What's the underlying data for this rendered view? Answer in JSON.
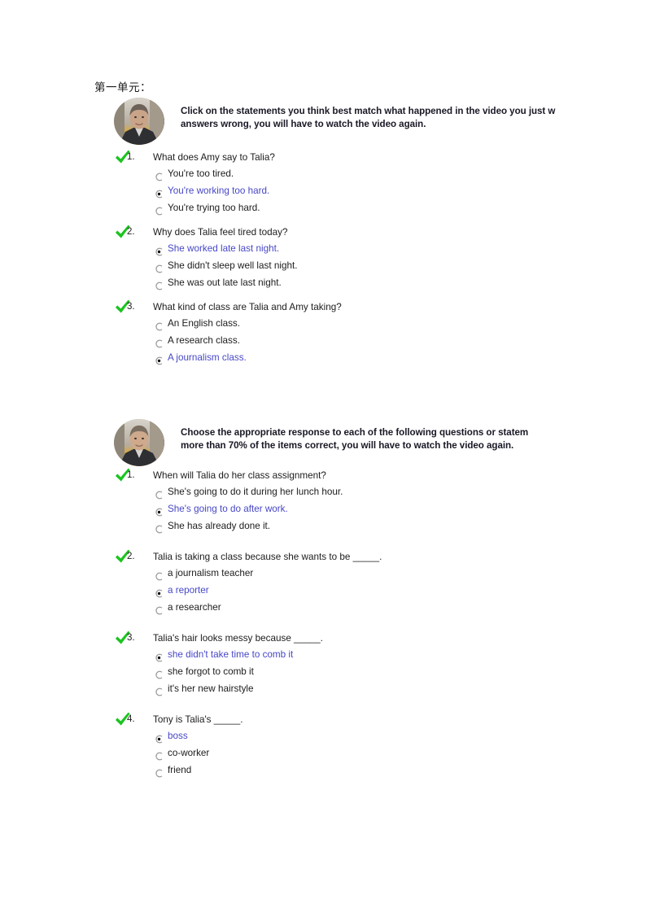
{
  "page": {
    "unit_heading": "第一单元：",
    "background_color": "#ffffff",
    "selected_option_color": "#4747c8",
    "default_text_color": "#1c1c1c",
    "check_color": "#16c21a"
  },
  "sections": [
    {
      "id": "section-1",
      "avatar_name": "instructor-avatar",
      "intro_lines": [
        "Click on the statements you think best match what happened in the video you just w",
        "answers wrong, you will have to watch the video again."
      ],
      "questions": [
        {
          "number": "1.",
          "status_icon": "green-check-icon",
          "text": "What does Amy say to Talia?",
          "options": [
            {
              "label": "You're too tired.",
              "selected": false
            },
            {
              "label": "You're working too hard.",
              "selected": true
            },
            {
              "label": "You're trying too hard.",
              "selected": false
            }
          ]
        },
        {
          "number": "2.",
          "status_icon": "green-check-icon",
          "text": "Why does Talia feel tired today?",
          "options": [
            {
              "label": "She worked late last night.",
              "selected": true
            },
            {
              "label": "She didn't sleep well last night.",
              "selected": false
            },
            {
              "label": "She was out late last night.",
              "selected": false
            }
          ]
        },
        {
          "number": "3.",
          "status_icon": "green-check-icon",
          "text": "What kind of class are Talia and Amy taking?",
          "options": [
            {
              "label": "An English class.",
              "selected": false
            },
            {
              "label": "A research class.",
              "selected": false
            },
            {
              "label": "A journalism class.",
              "selected": true
            }
          ]
        }
      ]
    },
    {
      "id": "section-2",
      "avatar_name": "instructor-avatar",
      "intro_lines": [
        "Choose the appropriate response to each of the following questions or statem",
        "more than 70% of the items correct, you will have to watch the video again."
      ],
      "questions": [
        {
          "number": "1.",
          "status_icon": "green-check-icon",
          "text": "When will Talia do her class assignment?",
          "options": [
            {
              "label": "She's going to do it during her lunch hour.",
              "selected": false
            },
            {
              "label": "She's going to do after work.",
              "selected": true
            },
            {
              "label": "She has already done it.",
              "selected": false
            }
          ]
        },
        {
          "number": "2.",
          "status_icon": "green-check-icon",
          "text": "Talia is taking a class because she wants to be _____.",
          "options": [
            {
              "label": "a journalism teacher",
              "selected": false
            },
            {
              "label": "a reporter",
              "selected": true
            },
            {
              "label": "a researcher",
              "selected": false
            }
          ]
        },
        {
          "number": "3.",
          "status_icon": "green-check-icon",
          "text": "Talia's hair looks messy because _____.",
          "options": [
            {
              "label": "she didn't take time to comb it",
              "selected": true
            },
            {
              "label": "she forgot to comb it",
              "selected": false
            },
            {
              "label": "it's her new hairstyle",
              "selected": false
            }
          ]
        },
        {
          "number": "4.",
          "status_icon": "green-check-icon",
          "text": "Tony is Talia's _____.",
          "options": [
            {
              "label": "boss",
              "selected": true
            },
            {
              "label": "co-worker",
              "selected": false
            },
            {
              "label": "friend",
              "selected": false
            }
          ]
        }
      ]
    }
  ]
}
